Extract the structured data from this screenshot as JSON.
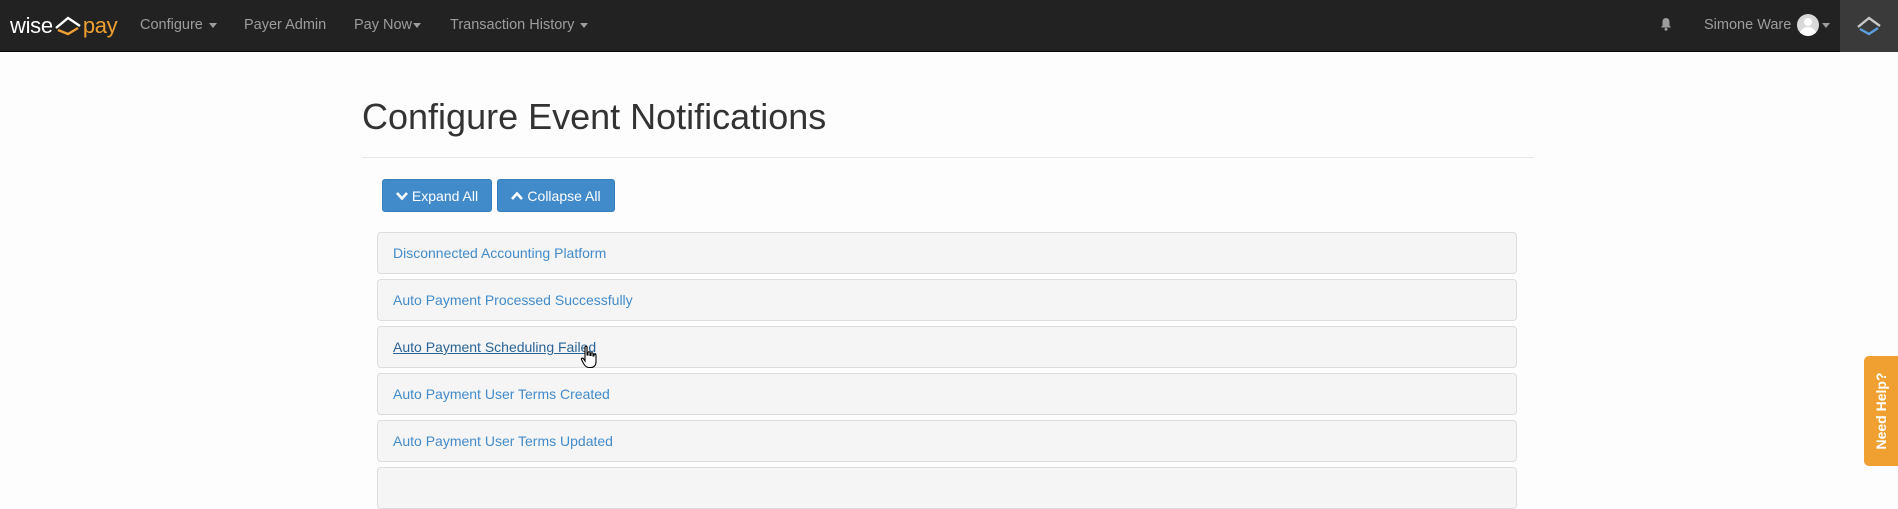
{
  "brand": {
    "left": "wise",
    "right": "pay"
  },
  "nav": [
    {
      "label": "Configure",
      "dropdown": true
    },
    {
      "label": "Payer Admin",
      "dropdown": false
    },
    {
      "label": "Pay Now",
      "dropdown": true
    },
    {
      "label": "Transaction History",
      "dropdown": true
    }
  ],
  "user": {
    "name": "Simone Ware"
  },
  "page": {
    "title": "Configure Event Notifications"
  },
  "buttons": {
    "expand_all": "Expand All",
    "collapse_all": "Collapse All"
  },
  "notifications": [
    "Disconnected Accounting Platform",
    "Auto Payment Processed Successfully",
    "Auto Payment Scheduling Failed",
    "Auto Payment User Terms Created",
    "Auto Payment User Terms Updated",
    ""
  ],
  "help": {
    "label": "Need Help?"
  },
  "colors": {
    "navbar": "#222222",
    "accent": "#428bca",
    "brand_orange": "#f0a030"
  }
}
